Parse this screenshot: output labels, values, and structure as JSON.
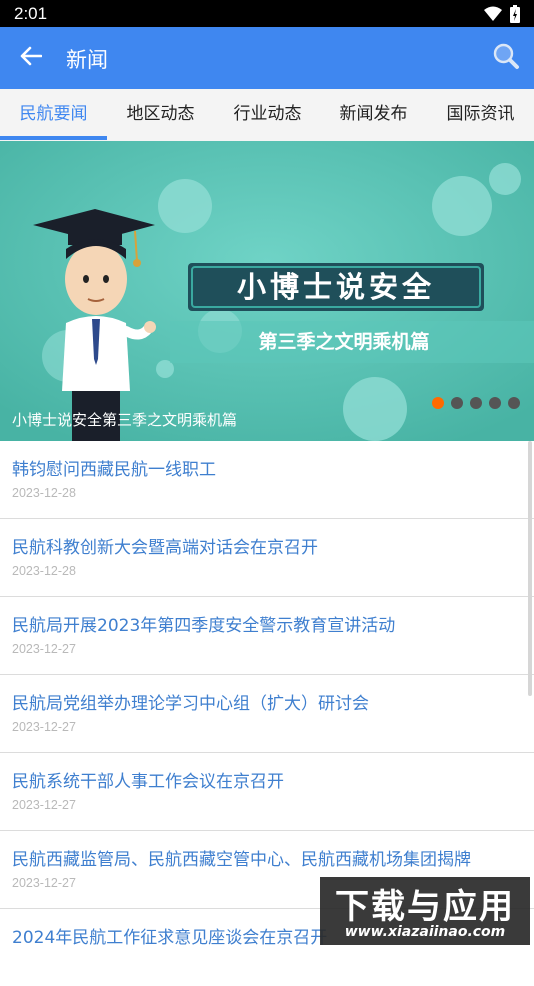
{
  "status_bar": {
    "time": "2:01"
  },
  "app_bar": {
    "title": "新闻"
  },
  "tabs": [
    {
      "label": "民航要闻"
    },
    {
      "label": "地区动态"
    },
    {
      "label": "行业动态"
    },
    {
      "label": "新闻发布"
    },
    {
      "label": "国际资讯"
    }
  ],
  "banner": {
    "headline": "小博士说安全",
    "subhead": "第三季之文明乘机篇",
    "caption": "小博士说安全第三季之文明乘机篇",
    "page_count": 5,
    "current_page": 1
  },
  "news": [
    {
      "title": "韩钧慰问西藏民航一线职工",
      "date": "2023-12-28"
    },
    {
      "title": "民航科教创新大会暨高端对话会在京召开",
      "date": "2023-12-28"
    },
    {
      "title": "民航局开展2023年第四季度安全警示教育宣讲活动",
      "date": "2023-12-27"
    },
    {
      "title": "民航局党组举办理论学习中心组（扩大）研讨会",
      "date": "2023-12-27"
    },
    {
      "title": "民航系统干部人事工作会议在京召开",
      "date": "2023-12-27"
    },
    {
      "title": "民航西藏监管局、民航西藏空管中心、民航西藏机场集团揭牌",
      "date": "2023-12-27"
    },
    {
      "title": "2024年民航工作征求意见座谈会在京召开",
      "date": ""
    }
  ],
  "watermark": {
    "main": "下载与应用",
    "sub": "www.xiazaiinao.com"
  },
  "colors": {
    "primary": "#3f87f0",
    "link": "#3f7fcf",
    "banner_bg": "#52bfb0",
    "dot_active": "#ff6a00"
  }
}
